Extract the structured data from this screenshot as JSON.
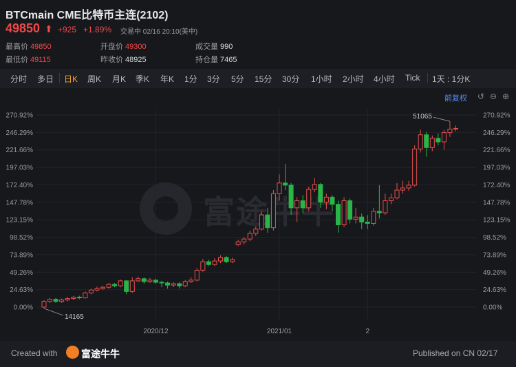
{
  "header": {
    "title": "BTCmain CME比特币主连(2102)",
    "price": "49850",
    "change": "+925",
    "change_pct": "+1.89%",
    "status": "交易中 02/16 20:10(美中)"
  },
  "stats": [
    {
      "label": "最高价",
      "value": "49850",
      "tone": "red"
    },
    {
      "label": "开盘价",
      "value": "49300",
      "tone": "red"
    },
    {
      "label": "成交量",
      "value": "990",
      "tone": "white"
    },
    {
      "label": "最低价",
      "value": "49115",
      "tone": "red"
    },
    {
      "label": "昨收价",
      "value": "48925",
      "tone": "white"
    },
    {
      "label": "持仓量",
      "value": "7465",
      "tone": "white"
    }
  ],
  "tabs": [
    "分时",
    "多日",
    "日K",
    "周K",
    "月K",
    "季K",
    "年K",
    "1分",
    "3分",
    "5分",
    "15分",
    "30分",
    "1小时",
    "2小时",
    "4小时",
    "Tick",
    "1天 : 1分K"
  ],
  "active_tab": "日K",
  "restore_label": "前复权",
  "icons": [
    "undo-icon",
    "minus-circle-icon",
    "plus-circle-icon"
  ],
  "watermark": "富途牛牛",
  "footer": {
    "created": "Created with",
    "brand": "富途牛牛",
    "published": "Published on CN 02/17"
  },
  "colors": {
    "up": "#e8504f",
    "down": "#29b548",
    "accent": "#f0a030",
    "link": "#5a8cf0"
  },
  "chart_data": {
    "type": "candlestick",
    "y_axis_ticks": [
      "270.92%",
      "246.29%",
      "221.66%",
      "197.03%",
      "172.40%",
      "147.78%",
      "123.15%",
      "98.52%",
      "73.89%",
      "49.26%",
      "24.63%",
      "0.00%"
    ],
    "ylim_pct": [
      0,
      270.92
    ],
    "x_axis_labels": [
      {
        "label": "2020/12",
        "index": 19
      },
      {
        "label": "2021/01",
        "index": 40
      },
      {
        "label": "2",
        "index": 55
      }
    ],
    "annotations": [
      {
        "text": "14165",
        "point": "low"
      },
      {
        "text": "51065",
        "point": "high"
      }
    ],
    "candles": [
      {
        "o": 0,
        "c": 8,
        "h": 10,
        "l": -2
      },
      {
        "o": 8,
        "c": 11,
        "h": 13,
        "l": 6
      },
      {
        "o": 11,
        "c": 8,
        "h": 13,
        "l": 6
      },
      {
        "o": 8,
        "c": 10,
        "h": 12,
        "l": 6
      },
      {
        "o": 10,
        "c": 12,
        "h": 14,
        "l": 8
      },
      {
        "o": 12,
        "c": 14,
        "h": 16,
        "l": 10
      },
      {
        "o": 14,
        "c": 13,
        "h": 16,
        "l": 11
      },
      {
        "o": 13,
        "c": 20,
        "h": 22,
        "l": 12
      },
      {
        "o": 20,
        "c": 24,
        "h": 26,
        "l": 18
      },
      {
        "o": 24,
        "c": 26,
        "h": 29,
        "l": 22
      },
      {
        "o": 26,
        "c": 28,
        "h": 30,
        "l": 24
      },
      {
        "o": 28,
        "c": 32,
        "h": 34,
        "l": 26
      },
      {
        "o": 32,
        "c": 30,
        "h": 34,
        "l": 28
      },
      {
        "o": 30,
        "c": 37,
        "h": 39,
        "l": 28
      },
      {
        "o": 37,
        "c": 22,
        "h": 38,
        "l": 18
      },
      {
        "o": 22,
        "c": 37,
        "h": 42,
        "l": 20
      },
      {
        "o": 37,
        "c": 40,
        "h": 43,
        "l": 35
      },
      {
        "o": 40,
        "c": 36,
        "h": 42,
        "l": 33
      },
      {
        "o": 36,
        "c": 38,
        "h": 41,
        "l": 34
      },
      {
        "o": 38,
        "c": 35,
        "h": 40,
        "l": 33
      },
      {
        "o": 35,
        "c": 34,
        "h": 37,
        "l": 28
      },
      {
        "o": 34,
        "c": 31,
        "h": 36,
        "l": 26
      },
      {
        "o": 31,
        "c": 33,
        "h": 35,
        "l": 28
      },
      {
        "o": 33,
        "c": 30,
        "h": 35,
        "l": 26
      },
      {
        "o": 30,
        "c": 36,
        "h": 38,
        "l": 28
      },
      {
        "o": 36,
        "c": 38,
        "h": 42,
        "l": 34
      },
      {
        "o": 38,
        "c": 52,
        "h": 55,
        "l": 36
      },
      {
        "o": 52,
        "c": 64,
        "h": 68,
        "l": 50
      },
      {
        "o": 64,
        "c": 60,
        "h": 67,
        "l": 58
      },
      {
        "o": 60,
        "c": 65,
        "h": 69,
        "l": 58
      },
      {
        "o": 65,
        "c": 70,
        "h": 73,
        "l": 62
      },
      {
        "o": 70,
        "c": 64,
        "h": 72,
        "l": 62
      },
      {
        "o": 64,
        "c": 67,
        "h": 70,
        "l": 62
      },
      {
        "o": 88,
        "c": 92,
        "h": 95,
        "l": 86
      },
      {
        "o": 92,
        "c": 96,
        "h": 99,
        "l": 88
      },
      {
        "o": 96,
        "c": 104,
        "h": 108,
        "l": 93
      },
      {
        "o": 104,
        "c": 110,
        "h": 114,
        "l": 100
      },
      {
        "o": 110,
        "c": 130,
        "h": 135,
        "l": 108
      },
      {
        "o": 130,
        "c": 112,
        "h": 140,
        "l": 105
      },
      {
        "o": 112,
        "c": 160,
        "h": 165,
        "l": 108
      },
      {
        "o": 160,
        "c": 175,
        "h": 187,
        "l": 150
      },
      {
        "o": 175,
        "c": 172,
        "h": 202,
        "l": 165
      },
      {
        "o": 172,
        "c": 140,
        "h": 175,
        "l": 130
      },
      {
        "o": 140,
        "c": 150,
        "h": 155,
        "l": 120
      },
      {
        "o": 150,
        "c": 140,
        "h": 158,
        "l": 132
      },
      {
        "o": 140,
        "c": 166,
        "h": 170,
        "l": 135
      },
      {
        "o": 166,
        "c": 173,
        "h": 182,
        "l": 162
      },
      {
        "o": 173,
        "c": 148,
        "h": 175,
        "l": 140
      },
      {
        "o": 148,
        "c": 155,
        "h": 160,
        "l": 138
      },
      {
        "o": 155,
        "c": 145,
        "h": 158,
        "l": 135
      },
      {
        "o": 145,
        "c": 116,
        "h": 150,
        "l": 105
      },
      {
        "o": 116,
        "c": 150,
        "h": 155,
        "l": 113
      },
      {
        "o": 150,
        "c": 124,
        "h": 153,
        "l": 118
      },
      {
        "o": 124,
        "c": 127,
        "h": 140,
        "l": 118
      },
      {
        "o": 127,
        "c": 120,
        "h": 132,
        "l": 110
      },
      {
        "o": 120,
        "c": 118,
        "h": 130,
        "l": 110
      },
      {
        "o": 118,
        "c": 135,
        "h": 140,
        "l": 115
      },
      {
        "o": 135,
        "c": 133,
        "h": 172,
        "l": 125
      },
      {
        "o": 133,
        "c": 150,
        "h": 160,
        "l": 130
      },
      {
        "o": 150,
        "c": 154,
        "h": 160,
        "l": 145
      },
      {
        "o": 154,
        "c": 165,
        "h": 175,
        "l": 152
      },
      {
        "o": 165,
        "c": 168,
        "h": 178,
        "l": 160
      },
      {
        "o": 168,
        "c": 172,
        "h": 178,
        "l": 164
      },
      {
        "o": 172,
        "c": 223,
        "h": 228,
        "l": 170
      },
      {
        "o": 223,
        "c": 243,
        "h": 250,
        "l": 218
      },
      {
        "o": 243,
        "c": 225,
        "h": 247,
        "l": 212
      },
      {
        "o": 225,
        "c": 238,
        "h": 242,
        "l": 220
      },
      {
        "o": 238,
        "c": 233,
        "h": 245,
        "l": 228
      },
      {
        "o": 233,
        "c": 246,
        "h": 250,
        "l": 222
      },
      {
        "o": 246,
        "c": 251,
        "h": 262,
        "l": 240
      },
      {
        "o": 251,
        "c": 252,
        "h": 256,
        "l": 248
      }
    ]
  }
}
